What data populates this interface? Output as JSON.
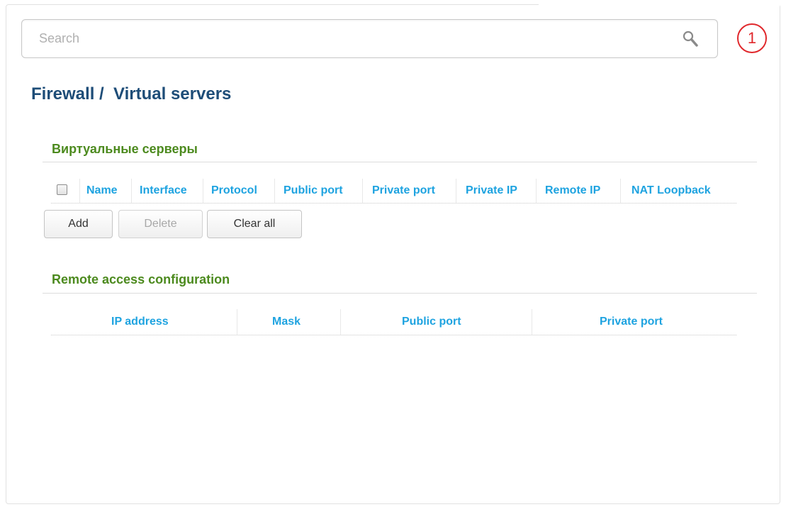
{
  "search": {
    "placeholder": "Search",
    "value": ""
  },
  "notifications": {
    "count": "1"
  },
  "page": {
    "title": "Firewall /  Virtual servers"
  },
  "virtual_servers": {
    "title": "Виртуальные серверы",
    "columns": [
      "Name",
      "Interface",
      "Protocol",
      "Public port",
      "Private port",
      "Private IP",
      "Remote IP",
      "NAT Loopback"
    ],
    "rows": [],
    "buttons": {
      "add": "Add",
      "delete": "Delete",
      "clear_all": "Clear all"
    }
  },
  "remote_access": {
    "title": "Remote access configuration",
    "columns": [
      "IP address",
      "Mask",
      "Public port",
      "Private port"
    ],
    "rows": []
  },
  "colors": {
    "title": "#1e4d78",
    "section_title": "#4c8a1e",
    "column_header": "#1ea3e0",
    "badge": "#e0282c"
  }
}
